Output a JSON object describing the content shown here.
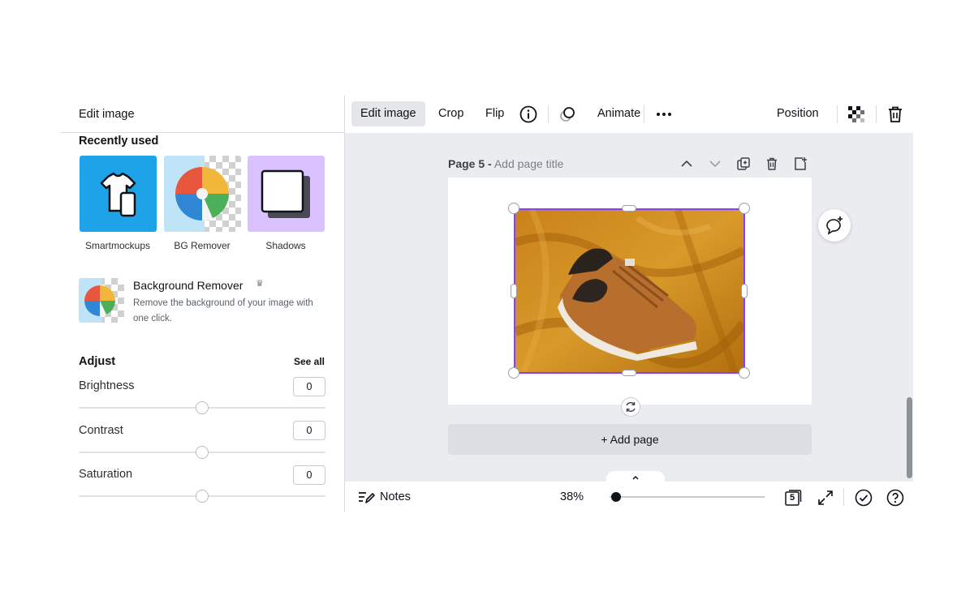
{
  "left_panel": {
    "header_title": "Edit image",
    "recently_used": {
      "title": "Recently used",
      "tiles": [
        {
          "label": "Smartmockups",
          "icon": "tshirt-phone-icon",
          "bg": "#1ea3e9"
        },
        {
          "label": "BG Remover",
          "icon": "beach-ball-icon"
        },
        {
          "label": "Shadows",
          "icon": "shadow-square-icon",
          "bg": "#d9c2ff"
        }
      ]
    },
    "bg_remover_card": {
      "title": "Background Remover",
      "badge_icon": "crown-icon",
      "description": "Remove the background of your image with one click."
    },
    "adjust": {
      "title": "Adjust",
      "see_all": "See all",
      "sliders": [
        {
          "label": "Brightness",
          "value": "0"
        },
        {
          "label": "Contrast",
          "value": "0"
        },
        {
          "label": "Saturation",
          "value": "0"
        }
      ]
    }
  },
  "toolbar": {
    "edit_image": "Edit image",
    "crop": "Crop",
    "flip": "Flip",
    "info_icon": "info-icon",
    "animate": "Animate",
    "more_icon": "more-icon",
    "position": "Position",
    "transparency_icon": "transparency-icon",
    "delete_icon": "trash-icon"
  },
  "canvas": {
    "page_number": "Page 5 -",
    "page_title_placeholder": "Add page title",
    "add_page": "+ Add page",
    "selection_color": "#8b3dff"
  },
  "bottom_bar": {
    "notes": "Notes",
    "zoom": "38%",
    "page_count": "5"
  },
  "colors": {
    "accent": "#8b3dff",
    "canvas_bg": "#ebecf0"
  }
}
